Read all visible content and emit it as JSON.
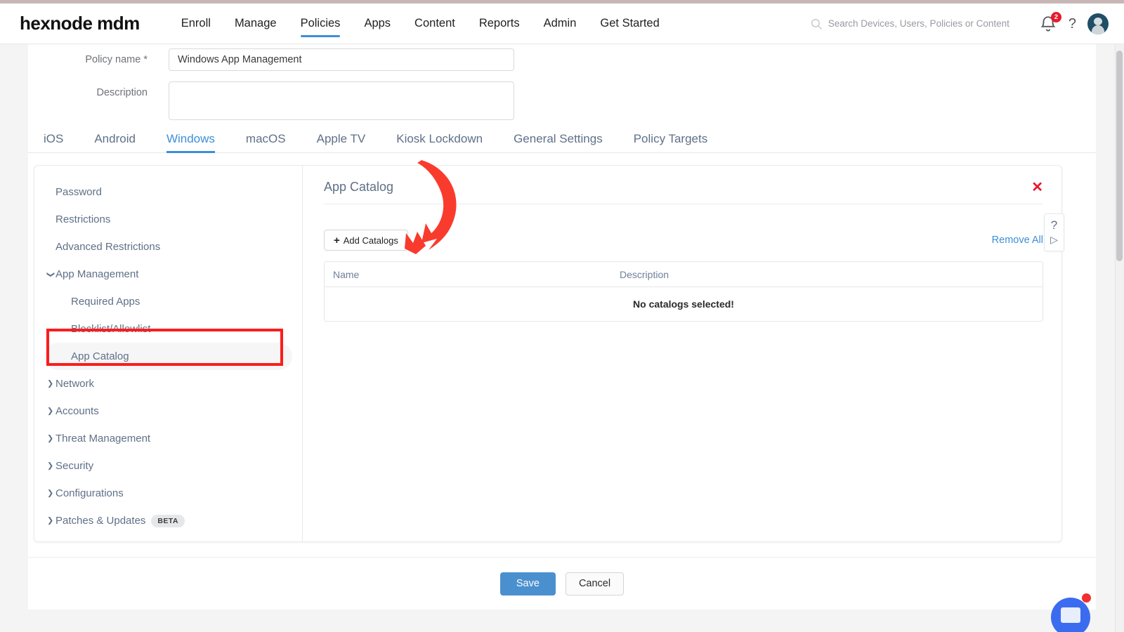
{
  "header": {
    "brand": "hexnode mdm",
    "nav": [
      {
        "label": "Enroll",
        "active": false
      },
      {
        "label": "Manage",
        "active": false
      },
      {
        "label": "Policies",
        "active": true
      },
      {
        "label": "Apps",
        "active": false
      },
      {
        "label": "Content",
        "active": false
      },
      {
        "label": "Reports",
        "active": false
      },
      {
        "label": "Admin",
        "active": false
      },
      {
        "label": "Get Started",
        "active": false
      }
    ],
    "search_placeholder": "Search Devices, Users, Policies or Content",
    "search_icon": "search-icon",
    "notification_icon": "bell-icon",
    "notification_count": "2",
    "help_icon": "question-mark-icon",
    "avatar_icon": "user-avatar"
  },
  "form": {
    "policy_name_label": "Policy name *",
    "policy_name_value": "Windows App Management",
    "description_label": "Description",
    "description_value": "",
    "description_placeholder": ""
  },
  "platform_tabs": [
    {
      "label": "iOS",
      "active": false
    },
    {
      "label": "Android",
      "active": false
    },
    {
      "label": "Windows",
      "active": true
    },
    {
      "label": "macOS",
      "active": false
    },
    {
      "label": "Apple TV",
      "active": false
    },
    {
      "label": "Kiosk Lockdown",
      "active": false
    },
    {
      "label": "General Settings",
      "active": false
    },
    {
      "label": "Policy Targets",
      "active": false
    }
  ],
  "sidebar": {
    "items": [
      {
        "label": "Password",
        "level": 0,
        "caret": "",
        "selected": false,
        "badge": ""
      },
      {
        "label": "Restrictions",
        "level": 0,
        "caret": "",
        "selected": false,
        "badge": ""
      },
      {
        "label": "Advanced Restrictions",
        "level": 0,
        "caret": "",
        "selected": false,
        "badge": ""
      },
      {
        "label": "App Management",
        "level": 0,
        "caret": "down",
        "selected": false,
        "badge": ""
      },
      {
        "label": "Required Apps",
        "level": 1,
        "caret": "",
        "selected": false,
        "badge": ""
      },
      {
        "label": "Blocklist/Allowlist",
        "level": 1,
        "caret": "",
        "selected": false,
        "badge": ""
      },
      {
        "label": "App Catalog",
        "level": 1,
        "caret": "",
        "selected": true,
        "badge": ""
      },
      {
        "label": "Network",
        "level": 0,
        "caret": "right",
        "selected": false,
        "badge": ""
      },
      {
        "label": "Accounts",
        "level": 0,
        "caret": "right",
        "selected": false,
        "badge": ""
      },
      {
        "label": "Threat Management",
        "level": 0,
        "caret": "right",
        "selected": false,
        "badge": ""
      },
      {
        "label": "Security",
        "level": 0,
        "caret": "right",
        "selected": false,
        "badge": ""
      },
      {
        "label": "Configurations",
        "level": 0,
        "caret": "right",
        "selected": false,
        "badge": ""
      },
      {
        "label": "Patches & Updates",
        "level": 0,
        "caret": "right",
        "selected": false,
        "badge": "BETA"
      }
    ]
  },
  "panel": {
    "title": "App Catalog",
    "close_icon": "close-x-icon",
    "add_button_label": "Add Catalogs",
    "add_button_icon": "plus-icon",
    "remove_all_label": "Remove All",
    "table": {
      "columns": [
        "Name",
        "Description"
      ],
      "rows": [],
      "empty_message": "No catalogs selected!"
    },
    "help_tab": {
      "question_icon": "question-mark-icon",
      "play_icon": "play-triangle-icon"
    }
  },
  "footer": {
    "save_label": "Save",
    "cancel_label": "Cancel"
  },
  "annotations": {
    "highlight_color": "#fb1d1d",
    "arrow_color": "#f93b2e",
    "highlight_target": "App Catalog",
    "arrow_target": "Add Catalogs"
  },
  "chat": {
    "widget_icon": "chat-bubble-icon",
    "unread_indicator": true
  }
}
